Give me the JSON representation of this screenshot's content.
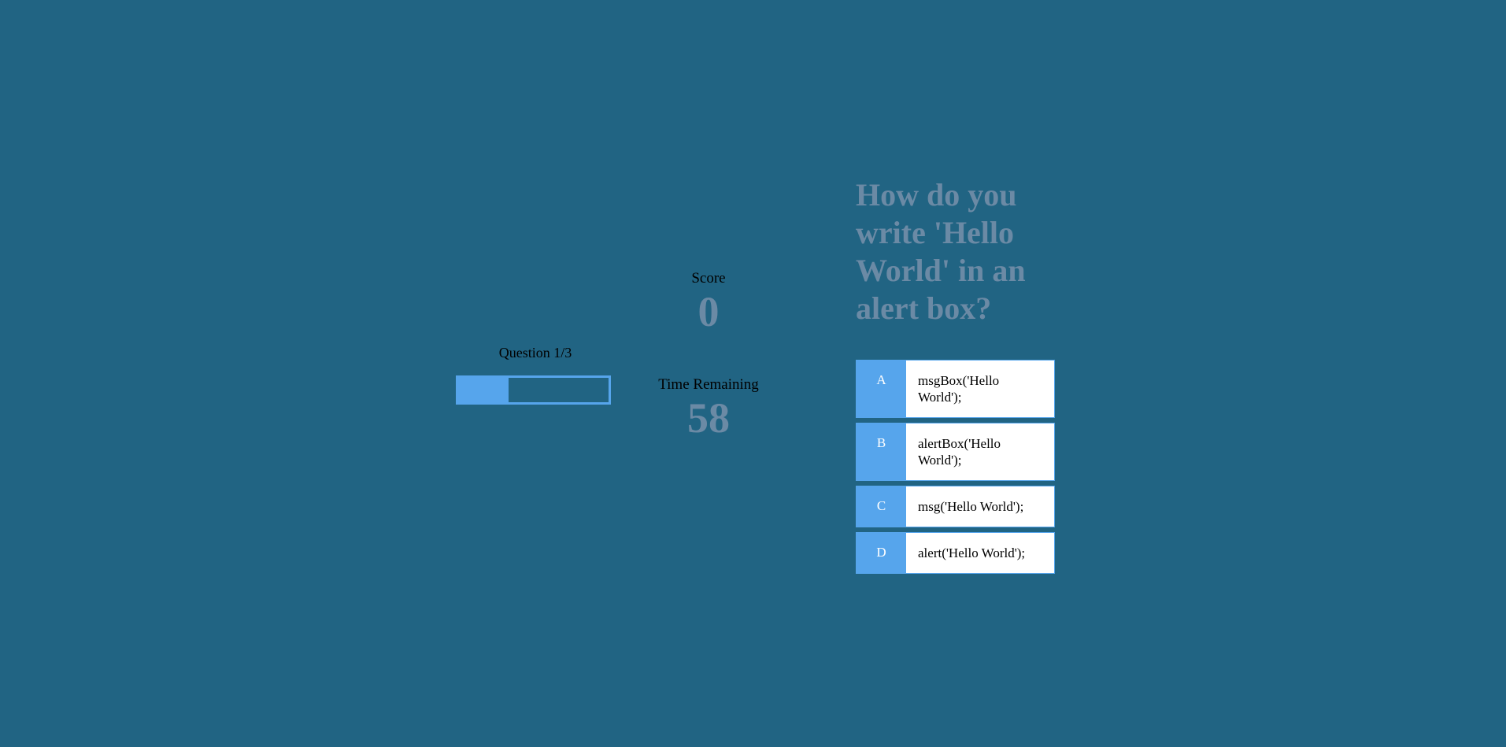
{
  "progress": {
    "label": "Question 1/3",
    "fraction": 0.333,
    "fill_color": "#56a5ec"
  },
  "score": {
    "label": "Score",
    "value": "0"
  },
  "timer": {
    "label": "Time Remaining",
    "value": "58"
  },
  "question": {
    "text": "How do you write 'Hello World' in an alert box?"
  },
  "choices": [
    {
      "prefix": "A",
      "text": "msgBox('Hello World');"
    },
    {
      "prefix": "B",
      "text": "alertBox('Hello World');"
    },
    {
      "prefix": "C",
      "text": "msg('Hello World');"
    },
    {
      "prefix": "D",
      "text": "alert('Hello World');"
    }
  ],
  "colors": {
    "background": "#216483",
    "accent": "#56a5ec",
    "muted_text": "#6b8aa5"
  }
}
